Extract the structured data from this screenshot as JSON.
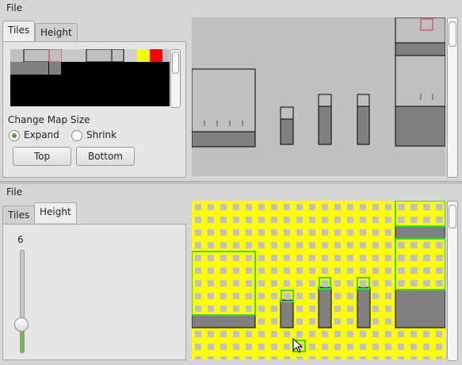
{
  "top_pane": {
    "menu": {
      "file_label": "File"
    },
    "tabs": [
      {
        "label": "Tiles",
        "active": true
      },
      {
        "label": "Height",
        "active": false
      }
    ],
    "palette": {
      "selected_colors": [
        "#ffff00",
        "#ff0000"
      ]
    },
    "map_size": {
      "title": "Change Map Size",
      "options": [
        {
          "label": "Expand",
          "checked": true
        },
        {
          "label": "Shrink",
          "checked": false
        }
      ],
      "buttons": {
        "top": "Top",
        "bottom": "Bottom"
      }
    }
  },
  "bottom_pane": {
    "menu": {
      "file_label": "File"
    },
    "tabs": [
      {
        "label": "Tiles",
        "active": false
      },
      {
        "label": "Height",
        "active": true
      }
    ],
    "height_slider": {
      "value": "6",
      "level_fraction": 0.27
    }
  },
  "colors": {
    "grid_yellow": "#ffff00",
    "grid_green": "#33dd33",
    "tile_gray": "#808080",
    "canvas_bg": "#c0c0c0"
  }
}
